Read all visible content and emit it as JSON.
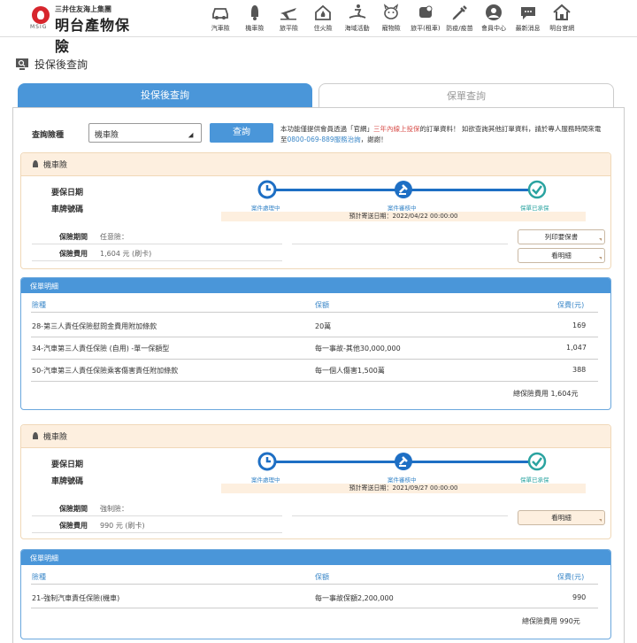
{
  "brand": {
    "sub": "三井住友海上集團",
    "main": "明台產物保險",
    "msig": "MSIG"
  },
  "nav": [
    {
      "label": "汽車險",
      "icon": "car-icon"
    },
    {
      "label": "機車險",
      "icon": "scooter-icon"
    },
    {
      "label": "旅平險",
      "icon": "airplane-icon"
    },
    {
      "label": "住火險",
      "icon": "house-fire-icon"
    },
    {
      "label": "海域活動",
      "icon": "surfing-icon"
    },
    {
      "label": "寵物險",
      "icon": "pet-icon"
    },
    {
      "label": "旅平(租車)",
      "icon": "rental-car-icon"
    },
    {
      "label": "防疫/疫苗",
      "icon": "vaccine-icon"
    },
    {
      "label": "會員中心",
      "icon": "member-icon"
    },
    {
      "label": "最新消息",
      "icon": "news-icon"
    },
    {
      "label": "明台官網",
      "icon": "home-icon"
    }
  ],
  "page_title": "投保後查詢",
  "tabs": {
    "active": "投保後查詢",
    "inactive": "保單查詢"
  },
  "query": {
    "label": "查詢險種",
    "selected": "機車險",
    "button": "查詢",
    "notice_a": "本功能僅提供會員透過「官網」",
    "notice_red": "三年內線上投保",
    "notice_b": "的訂單資料！ 如欲查詢其他訂單資料，請於專人服務時間來電至",
    "notice_phone": "0800-069-889服務治詢",
    "notice_c": "，謝謝！"
  },
  "policies": [
    {
      "type": "機車險",
      "start_label": "要保日期",
      "plate_label": "車牌號碼",
      "steps": [
        "案件處理中",
        "案件審核中",
        "保單已承保"
      ],
      "expected": "預計寄送日期：2022/04/22 00:00:00",
      "period_label": "保險期間",
      "period_value": "任意險：",
      "fee_label": "保險費用",
      "fee_value": "1,604 元 (刷卡)",
      "btn_print": "列印要保書",
      "btn_detail": "看明細",
      "detail": {
        "title": "保單明細",
        "headers": [
          "險種",
          "保額",
          "保費(元)"
        ],
        "rows": [
          [
            "28-第三人責任保險慰問金費用附加條款",
            "20萬",
            "169"
          ],
          [
            "34-汽車第三人責任保險 (自用) -單一保額型",
            "每一事故-其他30,000,000",
            "1,047"
          ],
          [
            "50-汽車第三人責任保險乘客傷害責任附加條款",
            "每一個人傷害1,500萬",
            "388"
          ]
        ],
        "total": "總保險費用 1,604元"
      }
    },
    {
      "type": "機車險",
      "start_label": "要保日期",
      "plate_label": "車牌號碼",
      "steps": [
        "案件處理中",
        "案件審核中",
        "保單已承保"
      ],
      "expected": "預計寄送日期：2021/09/27 00:00:00",
      "period_label": "保險期間",
      "period_value": "強制險：",
      "fee_label": "保險費用",
      "fee_value": "990 元 (刷卡)",
      "btn_detail": "看明細",
      "detail": {
        "title": "保單明細",
        "headers": [
          "險種",
          "保額",
          "保費(元)"
        ],
        "rows": [
          [
            "21-強制汽車責任保險(機車)",
            "每一事故保額2,200,000",
            "990"
          ]
        ],
        "total": "總保險費用 990元"
      }
    }
  ],
  "colors": {
    "primary": "#4a96d9",
    "peach": "#fdefdf",
    "step": "#1e6fc4",
    "done": "#2aa3a0",
    "red": "#d9534f"
  }
}
